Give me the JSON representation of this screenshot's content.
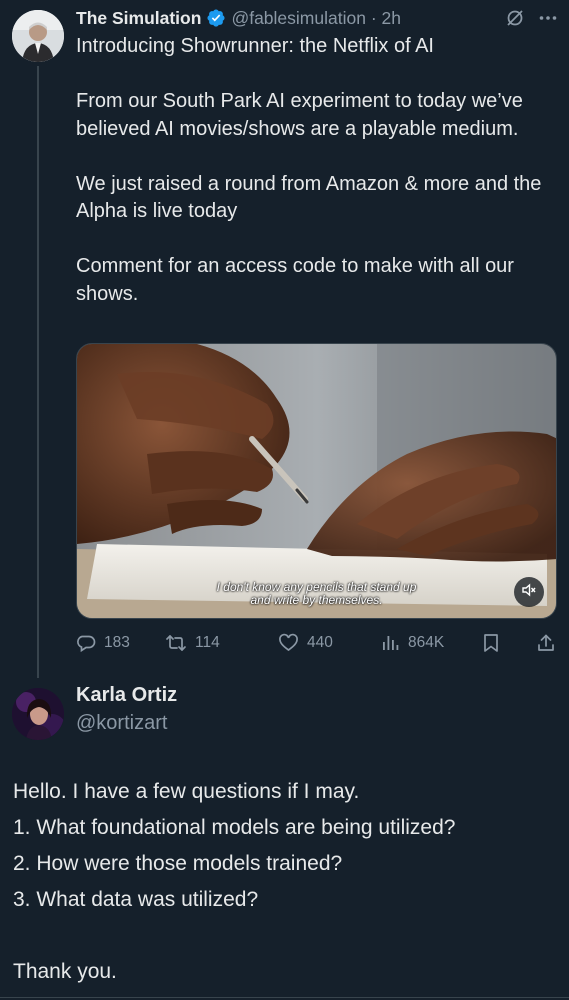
{
  "tweet": {
    "author_name": "The Simulation",
    "author_handle": "@fablesimulation",
    "separator": "·",
    "time": "2h",
    "paragraphs": [
      "Introducing Showrunner: the Netflix of AI",
      "From our South Park AI experiment to today we’ve believed AI movies/shows are a playable medium.",
      "We just raised a round from Amazon & more and the Alpha is live today",
      "Comment for an access code to make with all our shows."
    ],
    "media": {
      "caption_lines": [
        "I don't know any pencils that stand up",
        "and write by themselves."
      ],
      "mute_icon": "speaker-muted-icon"
    },
    "stats": {
      "replies": "183",
      "retweets": "114",
      "likes": "440",
      "views": "864K"
    },
    "icons": [
      "verified-badge-icon",
      "grok-icon",
      "more-icon",
      "reply-icon",
      "retweet-icon",
      "like-icon",
      "views-icon",
      "bookmark-icon",
      "share-icon"
    ]
  },
  "reply": {
    "author_name": "Karla Ortiz",
    "author_handle": "@kortizart",
    "lines": [
      "Hello. I have a few questions if I may.",
      "1. What foundational models are being utilized?",
      "2. How were those models trained?",
      "3. What data was utilized?"
    ],
    "closing": "Thank you."
  },
  "colors": {
    "background": "#15202b",
    "text": "#e7e9ea",
    "secondary": "#8b98a5",
    "verified": "#1d9bf0",
    "divider": "#38444d"
  }
}
